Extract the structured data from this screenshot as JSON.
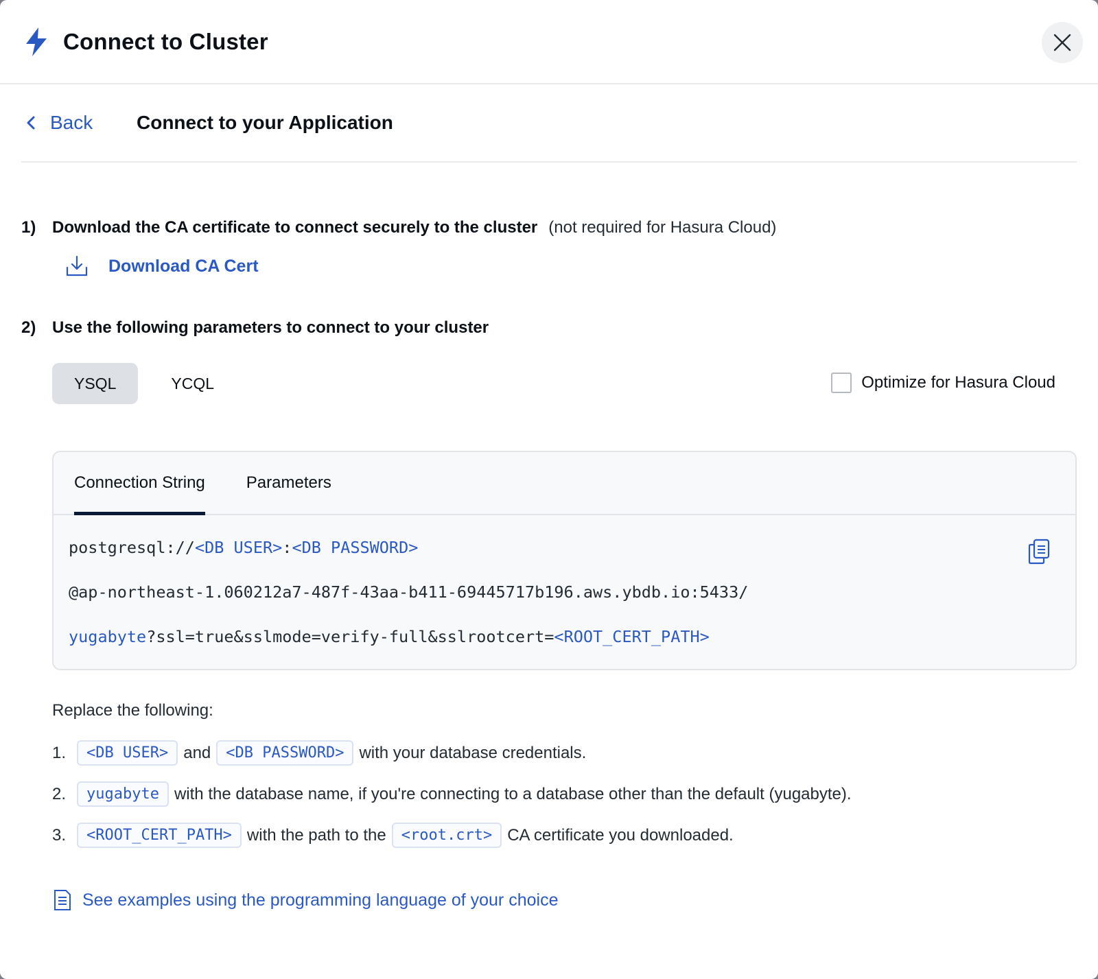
{
  "dialog": {
    "title": "Connect to Cluster",
    "icon": "lightning-bolt-icon",
    "accent_color": "#2b59c3"
  },
  "subnav": {
    "back_label": "Back",
    "subtitle": "Connect to your Application"
  },
  "step1": {
    "number": "1)",
    "text": "Download the CA certificate to connect securely to the cluster",
    "note": "(not required for Hasura Cloud)",
    "download_label": "Download CA Cert"
  },
  "step2": {
    "number": "2)",
    "text": "Use the following parameters to connect to your cluster"
  },
  "api_tabs": {
    "selected": "YSQL",
    "items": [
      "YSQL",
      "YCQL"
    ]
  },
  "hasura_option": {
    "label": "Optimize for Hasura Cloud",
    "checked": false
  },
  "connection": {
    "tabs": [
      "Connection String",
      "Parameters"
    ],
    "active_tab": "Connection String",
    "line1_plain": "postgresql://",
    "line1_user": "<DB USER>",
    "line1_sep": ":",
    "line1_password": "<DB PASSWORD>",
    "line2": "@ap-northeast-1.060212a7-487f-43aa-b411-69445717b196.aws.ybdb.io:5433/",
    "line3_db": "yugabyte",
    "line3_plain": "?ssl=true&sslmode=verify-full&sslrootcert=",
    "line3_cert": "<ROOT_CERT_PATH>"
  },
  "replace": {
    "title": "Replace the following:",
    "item1": {
      "idx": "1.",
      "tag_a": "<DB USER>",
      "and": "and",
      "tag_b": "<DB PASSWORD>",
      "text": "with your database credentials."
    },
    "item2": {
      "idx": "2.",
      "tag": "yugabyte",
      "text": "with the database name, if you're connecting to a database other than the default (yugabyte)."
    },
    "item3": {
      "idx": "3.",
      "tag_a": "<ROOT_CERT_PATH>",
      "mid": "with the path to the",
      "tag_b": "<root.crt>",
      "text": "CA certificate you downloaded."
    }
  },
  "examples_link": "See examples using the programming language of your choice"
}
